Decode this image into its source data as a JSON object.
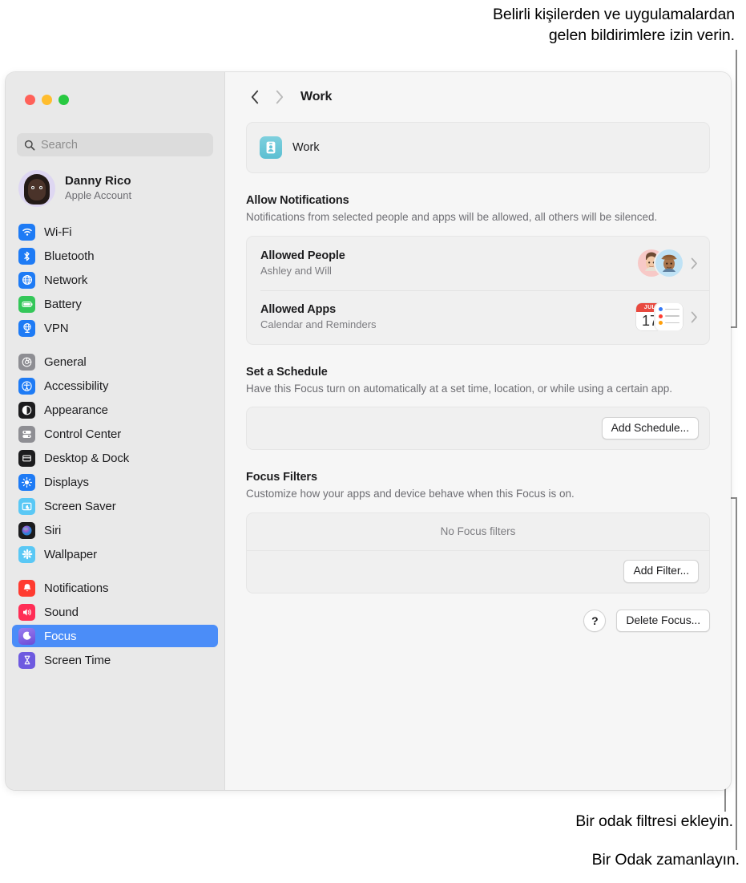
{
  "annotations": {
    "top": "Belirli kişilerden ve uygulamalardan\ngelen bildirimlere izin verin.",
    "filter": "Bir odak filtresi ekleyin.",
    "schedule": "Bir Odak zamanlayın."
  },
  "window": {
    "traffic_lights": [
      "close",
      "minimize",
      "zoom"
    ]
  },
  "sidebar": {
    "search": {
      "placeholder": "Search",
      "value": ""
    },
    "account": {
      "name": "Danny Rico",
      "subtitle": "Apple Account"
    },
    "groups": [
      {
        "items": [
          {
            "label": "Wi-Fi",
            "icon": "wifi-icon",
            "color": "#1e7bf5",
            "selected": false
          },
          {
            "label": "Bluetooth",
            "icon": "bluetooth-icon",
            "color": "#1e7bf5",
            "selected": false
          },
          {
            "label": "Network",
            "icon": "globe-icon",
            "color": "#1e7bf5",
            "selected": false
          },
          {
            "label": "Battery",
            "icon": "battery-icon",
            "color": "#34c759",
            "selected": false
          },
          {
            "label": "VPN",
            "icon": "vpn-icon",
            "color": "#1e7bf5",
            "selected": false
          }
        ]
      },
      {
        "items": [
          {
            "label": "General",
            "icon": "gear-icon",
            "color": "#8e8e93",
            "selected": false
          },
          {
            "label": "Accessibility",
            "icon": "accessibility-icon",
            "color": "#1e7bf5",
            "selected": false
          },
          {
            "label": "Appearance",
            "icon": "appearance-icon",
            "color": "#1c1c1e",
            "selected": false
          },
          {
            "label": "Control Center",
            "icon": "control-center-icon",
            "color": "#8e8e93",
            "selected": false
          },
          {
            "label": "Desktop & Dock",
            "icon": "desktop-dock-icon",
            "color": "#1c1c1e",
            "selected": false
          },
          {
            "label": "Displays",
            "icon": "displays-icon",
            "color": "#1e7bf5",
            "selected": false
          },
          {
            "label": "Screen Saver",
            "icon": "screen-saver-icon",
            "color": "#5ac8f5",
            "selected": false
          },
          {
            "label": "Siri",
            "icon": "siri-icon",
            "color": "#1c1c1e",
            "selected": false
          },
          {
            "label": "Wallpaper",
            "icon": "wallpaper-icon",
            "color": "#5ac8f5",
            "selected": false
          }
        ]
      },
      {
        "items": [
          {
            "label": "Notifications",
            "icon": "bell-icon",
            "color": "#ff3b30",
            "selected": false
          },
          {
            "label": "Sound",
            "icon": "speaker-icon",
            "color": "#ff2d55",
            "selected": false
          },
          {
            "label": "Focus",
            "icon": "moon-icon",
            "color": "#7b5ce0",
            "selected": true
          },
          {
            "label": "Screen Time",
            "icon": "hourglass-icon",
            "color": "#6e5ae0",
            "selected": false
          }
        ]
      }
    ],
    "selection_color": "#4b8df8"
  },
  "main": {
    "toolbar": {
      "back": "back-chevron",
      "forward": "forward-chevron",
      "title": "Work"
    },
    "profile": {
      "name": "Work",
      "icon": "work-badge-icon"
    },
    "sections": [
      {
        "title": "Allow Notifications",
        "description": "Notifications from selected people and apps will be allowed, all others will be silenced.",
        "rows": [
          {
            "title": "Allowed People",
            "subtitle": "Ashley and Will",
            "accessory": "memoji-pair"
          },
          {
            "title": "Allowed Apps",
            "subtitle": "Calendar and Reminders",
            "accessory": "calendar-reminders"
          }
        ]
      },
      {
        "title": "Set a Schedule",
        "description": "Have this Focus turn on automatically at a set time, location, or while using a certain app.",
        "button": "Add Schedule..."
      },
      {
        "title": "Focus Filters",
        "description": "Customize how your apps and device behave when this Focus is on.",
        "empty_text": "No Focus filters",
        "button": "Add Filter..."
      }
    ],
    "calendar_badge": {
      "month": "JUL",
      "day": "17"
    },
    "footer": {
      "help": "?",
      "delete": "Delete Focus..."
    }
  }
}
